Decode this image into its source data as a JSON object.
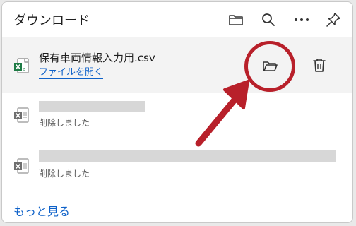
{
  "header": {
    "title": "ダウンロード",
    "icons": [
      "folder-icon",
      "search-icon",
      "more-icon",
      "pin-icon"
    ]
  },
  "active_download": {
    "file_name": "保有車両情報入力用.csv",
    "open_link": "ファイルを開く",
    "file_type_icon": "excel-csv-icon",
    "actions": [
      "open-folder-icon",
      "delete-icon"
    ]
  },
  "deleted_items": [
    {
      "status": "削除しました",
      "file_type_icon": "excel-icon"
    },
    {
      "status": "削除しました",
      "file_type_icon": "excel-icon"
    }
  ],
  "footer": {
    "more_label": "もっと見る"
  },
  "annotation": {
    "color": "#b8202a"
  },
  "colors": {
    "link": "#0f62c9",
    "selected_row": "#f3f3f3"
  }
}
